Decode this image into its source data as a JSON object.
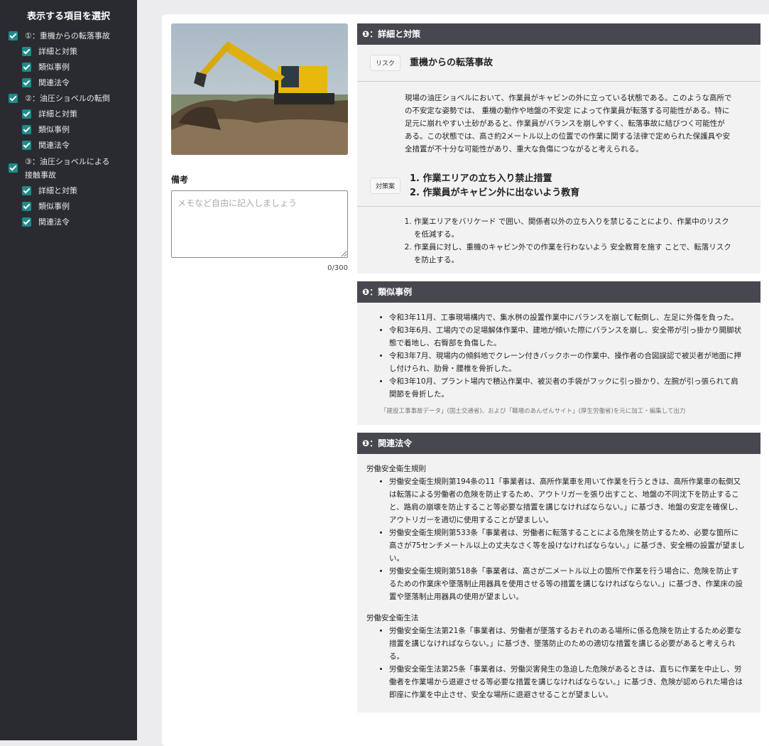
{
  "sidebar": {
    "title": "表示する項目を選択",
    "items": [
      {
        "label": "①：重機からの転落事故",
        "sub": [
          "詳細と対策",
          "類似事例",
          "関連法令"
        ]
      },
      {
        "label": "②：油圧ショベルの転倒",
        "sub": [
          "詳細と対策",
          "類似事例",
          "関連法令"
        ]
      },
      {
        "label": "③：油圧ショベルによる接触事故",
        "sub": [
          "詳細と対策",
          "類似事例",
          "関連法令"
        ]
      }
    ]
  },
  "memo": {
    "label": "備考",
    "placeholder": "メモなど自由に記入しましょう",
    "count": "0/300"
  },
  "details": {
    "header": "❶：詳細と対策",
    "risk_tag": "リスク",
    "risk_title": "重機からの転落事故",
    "description": "現場の油圧ショベルにおいて、作業員がキャビンの外に立っている状態である。このような高所での不安定な姿勢では、 重機の動作や地盤の不安定 によって作業員が転落する可能性がある。特に足元に崩れやすい土砂があると、作業員がバランスを崩しやすく、転落事故に結びつく可能性がある。この状態では、高さ約2メートル以上の位置での作業に関する法律で定められた保護具や安全措置が不十分な可能性があり、重大な負傷につながると考えられる。",
    "measure_tag": "対策案",
    "measure_titles": [
      "1. 作業エリアの立ち入り禁止措置",
      "2. 作業員がキャビン外に出ないよう教育"
    ],
    "measures": [
      "作業エリアをバリケード で囲い、関係者以外の立ち入りを禁じることにより、作業中のリスクを低減する。",
      "作業員に対し、重機のキャビン外での作業を行わないよう 安全教育を施す ことで、転落リスクを防止する。"
    ]
  },
  "cases": {
    "header": "❶：類似事例",
    "items": [
      "令和3年11月、工事現場構内で、集水桝の設置作業中にバランスを崩して転倒し、左足に外傷を負った。",
      "令和3年6月、工場内での足場解体作業中、建地が傾いた際にバランスを崩し、安全帯が引っ掛かり開脚状態で着地し、右臀部を負傷した。",
      "令和3年7月、現場内の傾斜地でクレーン付きバックホーの作業中、操作者の合図誤認で被災者が地面に押し付けられ、肋骨・腰椎を骨折した。",
      "令和3年10月、プラント場内で積込作業中、被災者の手袋がフックに引っ掛かり、左腕が引っ張られて肩関節を骨折した。"
    ],
    "source": "「建設工事事故データ」(国土交通省)、および「職場のあんぜんサイト」(厚生労働省)を元に加工・編集して出力"
  },
  "laws": {
    "header": "❶：関連法令",
    "groups": [
      {
        "name": "労働安全衛生規則",
        "items": [
          "労働安全衛生規則第194条の11「事業者は、高所作業車を用いて作業を行うときは、高所作業車の転倒又は転落による労働者の危険を防止するため、アウトリガーを張り出すこと、地盤の不同沈下を防止すること、路肩の崩壊を防止すること等必要な措置を講じなければならない。」に基づき、地盤の安定を確保し、アウトリガーを適切に使用することが望ましい。",
          "労働安全衛生規則第533条「事業者は、労働者に転落することによる危険を防止するため、必要な箇所に高さが75センチメートル以上の丈夫なさく等を設けなければならない。」に基づき、安全柵の設置が望ましい。",
          "労働安全衛生規則第518条「事業者は、高さが二メートル以上の箇所で作業を行う場合に、危険を防止するための作業床や墜落制止用器具を使用させる等の措置を講じなければならない。」に基づき、作業床の設置や墜落制止用器具の使用が望ましい。"
        ]
      },
      {
        "name": "労働安全衛生法",
        "items": [
          "労働安全衛生法第21条「事業者は、労働者が墜落するおそれのある場所に係る危険を防止するため必要な措置を講じなければならない。」に基づき、墜落防止のための適切な措置を講じる必要があると考えられる。",
          "労働安全衛生法第25条「事業者は、労働災害発生の急迫した危険があるときは、直ちに作業を中止し、労働者を作業場から退避させる等必要な措置を講じなければならない。」に基づき、危険が認められた場合は即座に作業を中止させ、安全な場所に退避させることが望ましい。"
        ]
      }
    ]
  }
}
